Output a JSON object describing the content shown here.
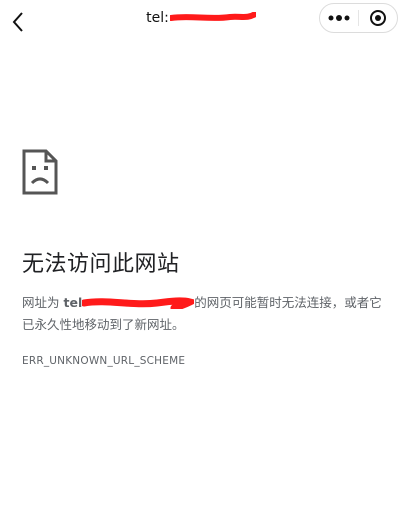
{
  "topbar": {
    "title_prefix": "tel:",
    "back_icon": "chevron-left-icon",
    "more_icon": "more-dots-icon",
    "close_icon": "target-circle-icon"
  },
  "error": {
    "icon": "sad-page-icon",
    "title": "无法访问此网站",
    "desc_prefix": "网址为 ",
    "desc_url_prefix": "tel",
    "desc_suffix": "的网页可能暂时无法连接，或者它已永久性地移动到了新网址。",
    "code": "ERR_UNKNOWN_URL_SCHEME"
  },
  "colors": {
    "redaction": "#ff1a1a",
    "text_primary": "#202124",
    "text_secondary": "#5f6368"
  }
}
